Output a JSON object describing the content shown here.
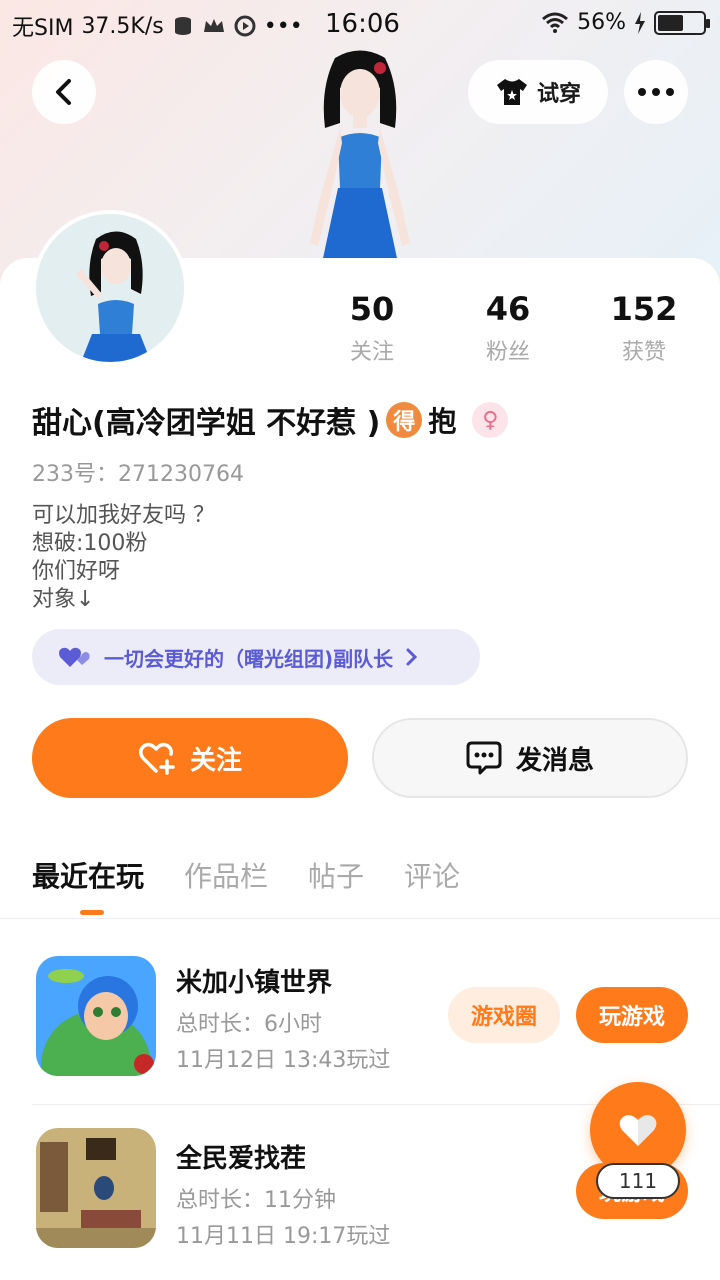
{
  "status_bar": {
    "carrier": "无SIM",
    "speed": "37.5K/s",
    "time": "16:06",
    "battery_pct": "56%",
    "battery_level": 0.56
  },
  "header": {
    "tryon_label": "试穿"
  },
  "profile": {
    "stats": [
      {
        "num": "50",
        "label": "关注"
      },
      {
        "num": "46",
        "label": "粉丝"
      },
      {
        "num": "152",
        "label": "获赞"
      }
    ],
    "nickname": "甜心(高冷团学姐 不好惹 )",
    "badge_de": "得",
    "badge_bao": "抱",
    "gender_symbol": "♀",
    "uid": "233号：271230764",
    "bio": [
      "可以加我好友吗 ？",
      "想破:100粉",
      "你们好呀",
      "对象↓"
    ],
    "team": "一切会更好的（曙光组团)副队长"
  },
  "actions": {
    "follow_label": "关注",
    "message_label": "发消息"
  },
  "tabs": [
    "最近在玩",
    "作品栏",
    "帖子",
    "评论"
  ],
  "games": [
    {
      "name": "米加小镇世界",
      "duration": "总时长：6小时",
      "last_played": "11月12日 13:43玩过",
      "circle_label": "游戏圈",
      "play_label": "玩游戏"
    },
    {
      "name": "全民爱找茬",
      "duration": "总时长：11分钟",
      "last_played": "11月11日 19:17玩过",
      "play_label": "玩游戏"
    }
  ],
  "float": {
    "count": "111"
  },
  "colors": {
    "accent": "#ff7a1a",
    "team_chip_bg": "#ecebf8",
    "team_chip_text": "#5b5bd6"
  }
}
